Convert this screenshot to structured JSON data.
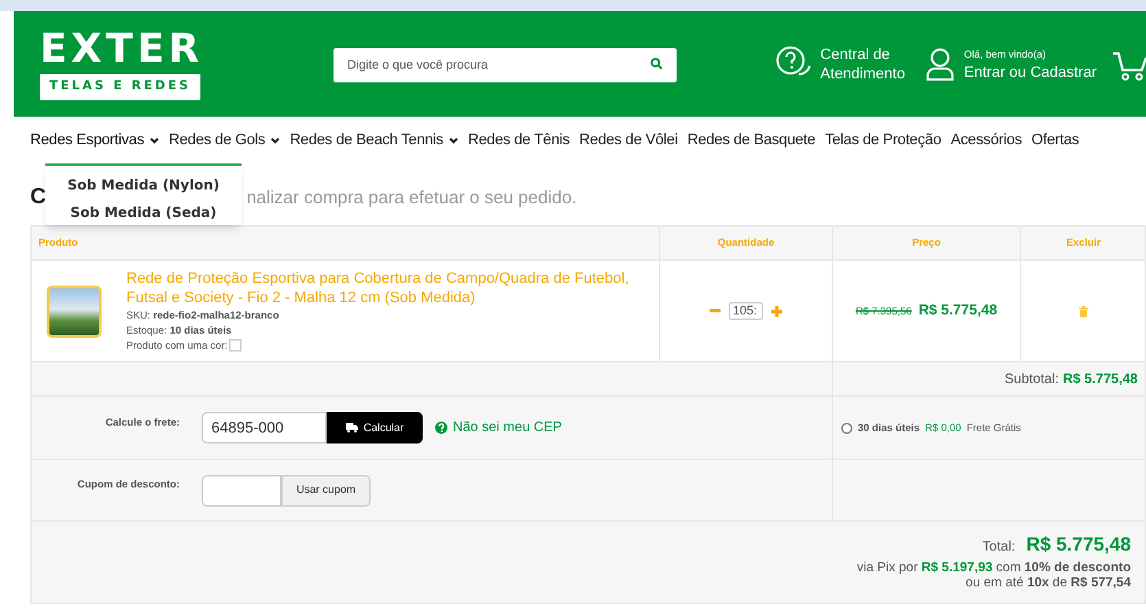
{
  "header": {
    "logo": {
      "name": "EXTER",
      "tagline": "TELAS E REDES"
    },
    "search": {
      "placeholder": "Digite o que você procura"
    },
    "support": {
      "line1": "Central de",
      "line2": "Atendimento"
    },
    "account": {
      "greeting": "Olá, bem vindo(a)",
      "link": "Entrar ou Cadastrar"
    }
  },
  "nav": [
    {
      "label": "Redes Esportivas",
      "has_menu": true,
      "expanded": true
    },
    {
      "label": "Redes de Gols",
      "has_menu": true,
      "expanded": false
    },
    {
      "label": "Redes de Beach Tennis",
      "has_menu": true,
      "expanded": false
    },
    {
      "label": "Redes de Tênis",
      "has_menu": false,
      "expanded": false
    },
    {
      "label": "Redes de Vôlei",
      "has_menu": false,
      "expanded": false
    },
    {
      "label": "Redes de Basquete",
      "has_menu": false,
      "expanded": false
    },
    {
      "label": "Telas de Proteção",
      "has_menu": false,
      "expanded": false
    },
    {
      "label": "Acessórios",
      "has_menu": false,
      "expanded": false
    },
    {
      "label": "Ofertas",
      "has_menu": false,
      "expanded": false
    }
  ],
  "dropdown": [
    "Sob Medida (Nylon)",
    "Sob Medida (Seda)"
  ],
  "page": {
    "title": "C",
    "subtitle": "nalizar compra para efetuar o seu pedido."
  },
  "table": {
    "columns": [
      "Produto",
      "Quantidade",
      "Preço",
      "Excluir"
    ],
    "rows": [
      {
        "name": "Rede de Proteção Esportiva para Cobertura de Campo/Quadra de Futebol, Futsal e Society - Fio 2 - Malha 12 cm (Sob Medida)",
        "sku_label": "SKU:",
        "sku": "rede-fio2-malha12-branco",
        "stock_label": "Estoque:",
        "stock": "10 dias úteis",
        "color_label": "Produto com uma cor:",
        "quantity": "105:",
        "old_price": "R$ 7.395,56",
        "price": "R$ 5.775,48"
      }
    ]
  },
  "subtotal": {
    "label": "Subtotal:",
    "value": "R$ 5.775,48"
  },
  "shipping": {
    "label": "Calcule o frete:",
    "value": "64895-000",
    "button": "Calcular",
    "help": "Não sei meu CEP",
    "options": [
      {
        "days": "30 dias úteis",
        "price": "R$ 0,00",
        "note": "Frete Grátis",
        "selected": false
      }
    ]
  },
  "coupon": {
    "label": "Cupom de desconto:",
    "button": "Usar cupom"
  },
  "total": {
    "label": "Total:",
    "value": "R$ 5.775,48",
    "pix": "via Pix por **R$ 5.197,93** com **10% de desconto**",
    "installments": "ou em até **10x** de **R$ 577,54**"
  }
}
